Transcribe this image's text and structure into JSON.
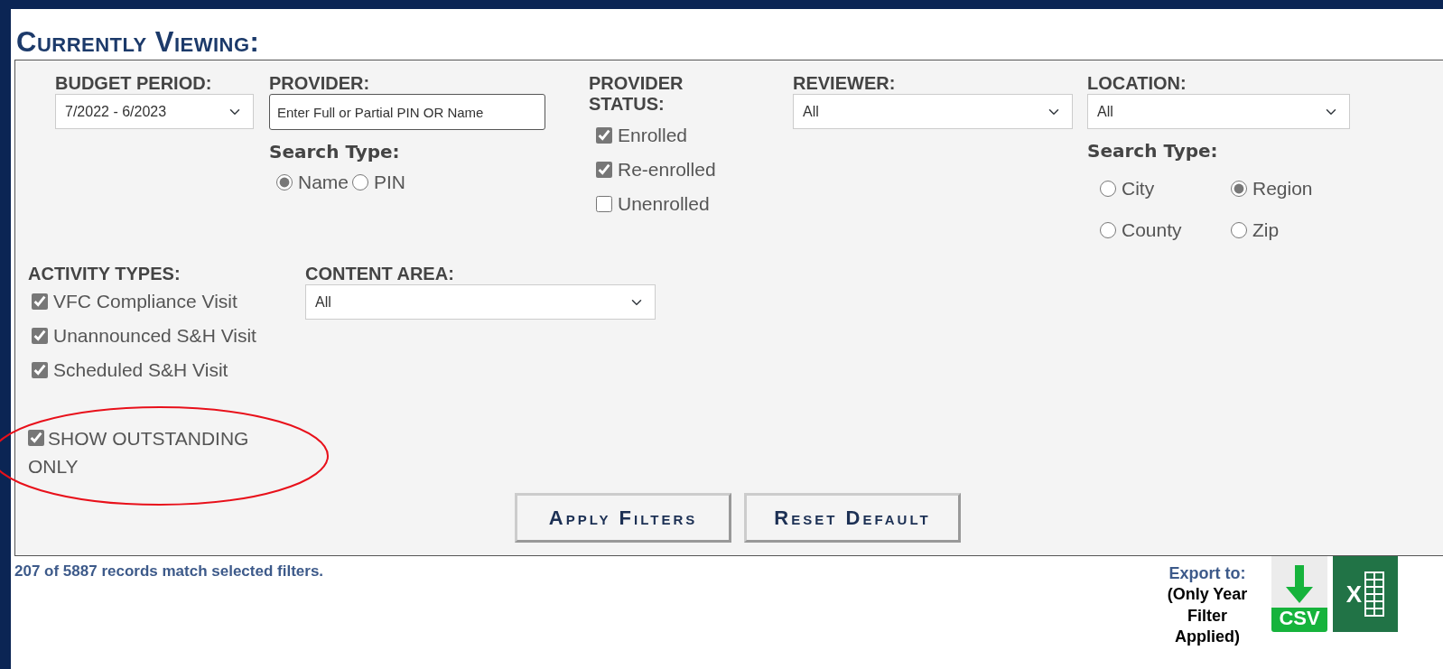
{
  "title": "Currently Viewing:",
  "filters": {
    "budget_period": {
      "label": "BUDGET PERIOD:",
      "value": "7/2022 - 6/2023"
    },
    "provider": {
      "label": "PROVIDER:",
      "placeholder": "Enter Full or Partial PIN OR Name",
      "search_type_label": "Search Type:",
      "search_types": [
        {
          "label": "Name",
          "selected": true
        },
        {
          "label": "PIN",
          "selected": false
        }
      ]
    },
    "provider_status": {
      "label": "PROVIDER STATUS:",
      "options": [
        {
          "label": "Enrolled",
          "checked": true
        },
        {
          "label": "Re-enrolled",
          "checked": true
        },
        {
          "label": "Unenrolled",
          "checked": false
        }
      ]
    },
    "reviewer": {
      "label": "REVIEWER:",
      "value": "All"
    },
    "location": {
      "label": "LOCATION:",
      "value": "All",
      "search_type_label": "Search Type:",
      "search_types": [
        {
          "label": "City",
          "selected": false
        },
        {
          "label": "Region",
          "selected": true
        },
        {
          "label": "County",
          "selected": false
        },
        {
          "label": "Zip",
          "selected": false
        }
      ]
    },
    "activity_types": {
      "label": "ACTIVITY TYPES:",
      "options": [
        {
          "label": "VFC Compliance Visit",
          "checked": true
        },
        {
          "label": "Unannounced S&H Visit",
          "checked": true
        },
        {
          "label": "Scheduled S&H Visit",
          "checked": true
        }
      ]
    },
    "content_area": {
      "label": "CONTENT AREA:",
      "value": "All"
    },
    "show_outstanding_only": {
      "label": "SHOW OUTSTANDING ONLY",
      "checked": true,
      "circled": true
    }
  },
  "buttons": [
    "Apply Filters",
    "Reset Default"
  ],
  "record_count": "207 of 5887 records match selected filters.",
  "export": {
    "label": "Export to:",
    "note": "(Only Year Filter Applied)",
    "csv_label": "CSV",
    "excel_label": "X"
  }
}
